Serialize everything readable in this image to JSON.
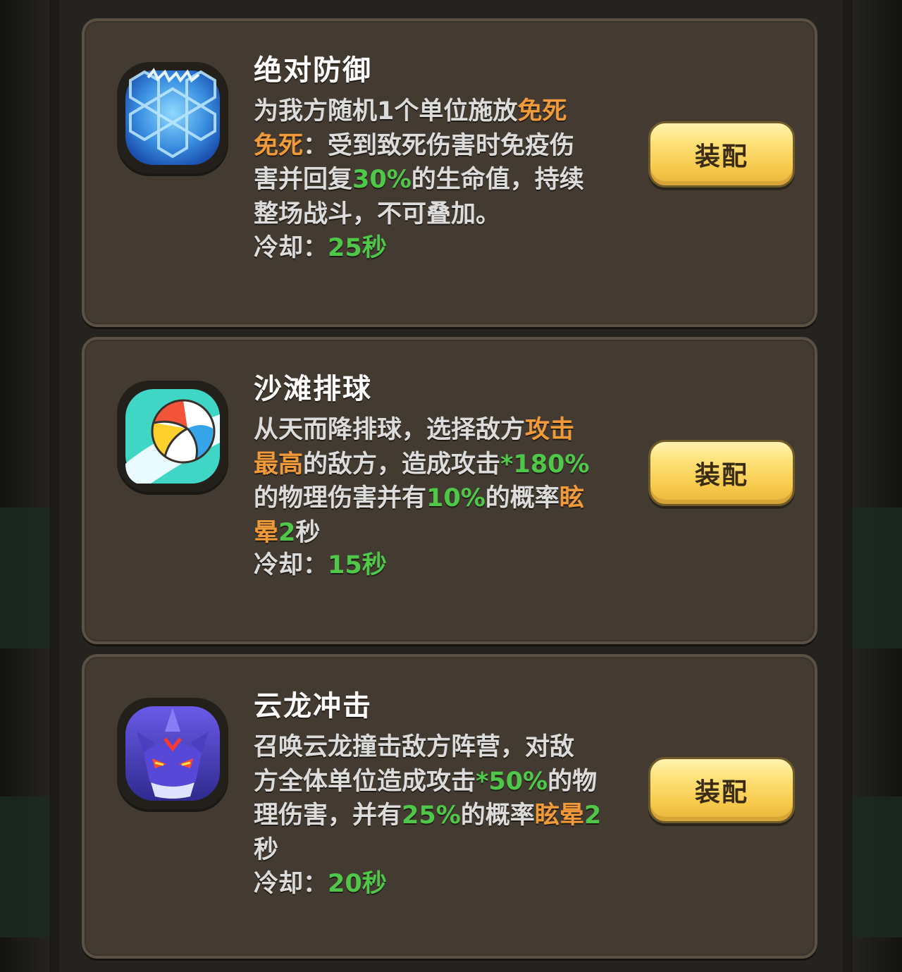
{
  "cards": [
    {
      "title": "绝对防御",
      "icon": "shield-hexagon-icon",
      "desc": [
        {
          "t": "为我方随机1个单位施放",
          "c": "normal"
        },
        {
          "t": "免死",
          "c": "orange"
        },
        {
          "t": "\n",
          "c": "normal"
        },
        {
          "t": "免死",
          "c": "orange"
        },
        {
          "t": "：受到致死伤害时免疫伤\n害并回复",
          "c": "normal"
        },
        {
          "t": "30%",
          "c": "green"
        },
        {
          "t": "的生命值，持续\n整场战斗，不可叠加。",
          "c": "normal"
        }
      ],
      "cooldown_label": "冷却：",
      "cooldown_value": "25秒",
      "button": "装配"
    },
    {
      "title": "沙滩排球",
      "icon": "volleyball-icon",
      "desc": [
        {
          "t": "从天而降排球，选择敌方",
          "c": "normal"
        },
        {
          "t": "攻击\n最高",
          "c": "orange"
        },
        {
          "t": "的敌方，造成攻击",
          "c": "normal"
        },
        {
          "t": "*180%",
          "c": "green"
        },
        {
          "t": "\n的物理伤害并有",
          "c": "normal"
        },
        {
          "t": "10%",
          "c": "green"
        },
        {
          "t": "的概率",
          "c": "normal"
        },
        {
          "t": "眩\n晕",
          "c": "orange"
        },
        {
          "t": "2",
          "c": "green"
        },
        {
          "t": "秒",
          "c": "normal"
        }
      ],
      "cooldown_label": "冷却：",
      "cooldown_value": "15秒",
      "button": "装配"
    },
    {
      "title": "云龙冲击",
      "icon": "dragon-icon",
      "desc": [
        {
          "t": "召唤云龙撞击敌方阵营，对敌\n方全体单位造成攻击",
          "c": "normal"
        },
        {
          "t": "*50%",
          "c": "green"
        },
        {
          "t": "的物\n理伤害，并有",
          "c": "normal"
        },
        {
          "t": "25%",
          "c": "green"
        },
        {
          "t": "的概率",
          "c": "normal"
        },
        {
          "t": "眩晕",
          "c": "orange"
        },
        {
          "t": "2",
          "c": "green"
        },
        {
          "t": "\n秒",
          "c": "normal"
        }
      ],
      "cooldown_label": "冷却：",
      "cooldown_value": "20秒",
      "button": "装配"
    }
  ]
}
